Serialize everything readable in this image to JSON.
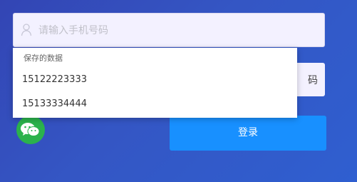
{
  "phone": {
    "placeholder": "请输入手机号码",
    "icon": "user-icon"
  },
  "code": {
    "partial_label": "码"
  },
  "login": {
    "label": "登录"
  },
  "wechat": {
    "icon": "wechat-icon"
  },
  "autocomplete": {
    "header": "保存的数据",
    "items": [
      "15122223333",
      "15133334444"
    ]
  },
  "colors": {
    "primary": "#1890ff",
    "wechat": "#2bb24c",
    "input_bg": "#f3f1ff"
  }
}
